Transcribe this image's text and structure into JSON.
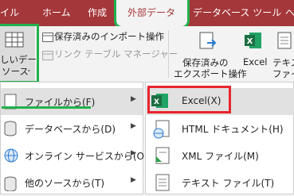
{
  "tabs": {
    "file": "イル",
    "home": "ホーム",
    "create": "作成",
    "external": "外部データ",
    "db_tools": "データベース ツール",
    "help": "ヘ"
  },
  "ribbon": {
    "new_source_line1": "しいデー",
    "new_source_line2": "ソース",
    "saved_imports": "保存済みのインポート操作",
    "linked_table_manager": "リンク テーブル マネージャー",
    "saved_exports_line1": "保存済みの",
    "saved_exports_line2": "エクスポート操作",
    "excel": "Excel",
    "text_file_line1": "テキス",
    "text_file_line2": "ファイ"
  },
  "left_menu": {
    "items": [
      {
        "label": "ファイルから(F)"
      },
      {
        "label": "データベースから(D)"
      },
      {
        "label": "オンライン サービスから(O)"
      },
      {
        "label": "他のソースから(T)"
      }
    ]
  },
  "sub_menu": {
    "items": [
      {
        "label": "Excel(X)"
      },
      {
        "label": "HTML ドキュメント(H)"
      },
      {
        "label": "XML ファイル(M)"
      },
      {
        "label": "テキスト ファイル(T)"
      }
    ]
  },
  "colors": {
    "accent": "#a4373a",
    "highlight_red": "#e8242c",
    "highlight_green": "#23b14d",
    "excel_green": "#1d6f42"
  }
}
